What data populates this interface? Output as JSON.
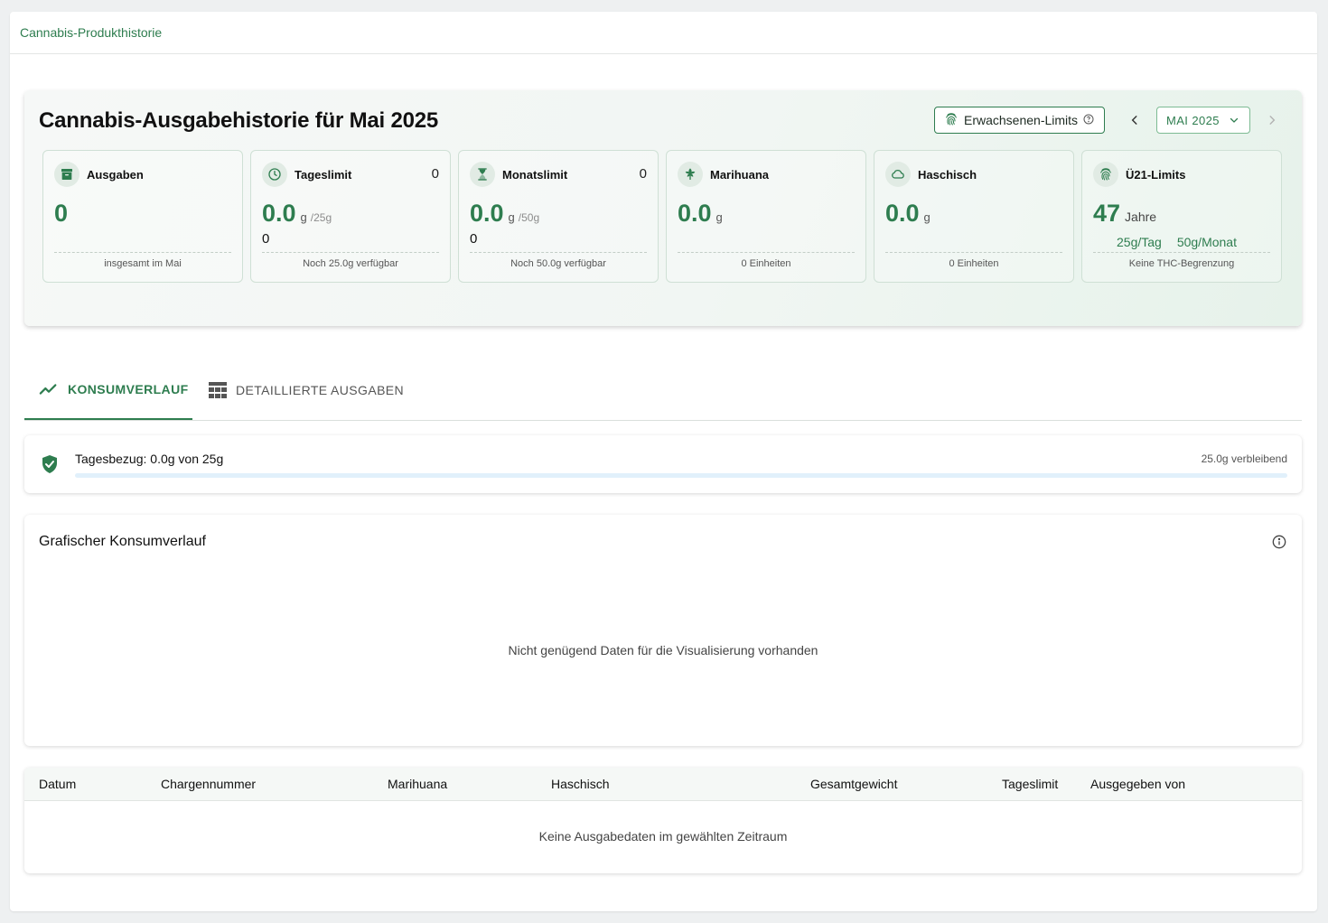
{
  "breadcrumb": "Cannabis-Produkthistorie",
  "hero": {
    "title": "Cannabis-Ausgabehistorie für Mai 2025",
    "limits_button": "Erwachsenen-Limits",
    "month": "MAI 2025"
  },
  "cards": {
    "ausgaben": {
      "title": "Ausgaben",
      "value": "0",
      "footer": "insgesamt im Mai"
    },
    "tageslimit": {
      "title": "Tageslimit",
      "count": "0",
      "value": "0.0",
      "unit": "g",
      "limit": "/25g",
      "sub": "0",
      "footer": "Noch 25.0g verfügbar"
    },
    "monatslimit": {
      "title": "Monatslimit",
      "count": "0",
      "value": "0.0",
      "unit": "g",
      "limit": "/50g",
      "sub": "0",
      "footer": "Noch 50.0g verfügbar"
    },
    "marihuana": {
      "title": "Marihuana",
      "value": "0.0",
      "unit": "g",
      "footer": "0 Einheiten"
    },
    "haschisch": {
      "title": "Haschisch",
      "value": "0.0",
      "unit": "g",
      "footer": "0 Einheiten"
    },
    "u21": {
      "title": "Ü21-Limits",
      "value": "47",
      "unit": "Jahre",
      "per_day": "25g/Tag",
      "per_month": "50g/Monat",
      "footer": "Keine THC-Begrenzung"
    }
  },
  "tabs": [
    {
      "label": "KONSUMVERLAUF",
      "active": true
    },
    {
      "label": "DETAILLIERTE AUSGABEN",
      "active": false
    }
  ],
  "daily": {
    "label": "Tagesbezug: 0.0g von 25g",
    "remaining": "25.0g verbleibend",
    "progress_fraction": 0
  },
  "chart": {
    "title": "Grafischer Konsumverlauf",
    "empty_message": "Nicht genügend Daten für die Visualisierung vorhanden"
  },
  "table": {
    "columns": [
      "Datum",
      "Chargennummer",
      "Marihuana",
      "Haschisch",
      "Gesamtgewicht",
      "Tageslimit",
      "Ausgegeben von"
    ],
    "empty_message": "Keine Ausgabedaten im gewählten Zeitraum"
  },
  "colors": {
    "accent": "#2e7d4f",
    "progress_track": "#e1f0fb"
  }
}
